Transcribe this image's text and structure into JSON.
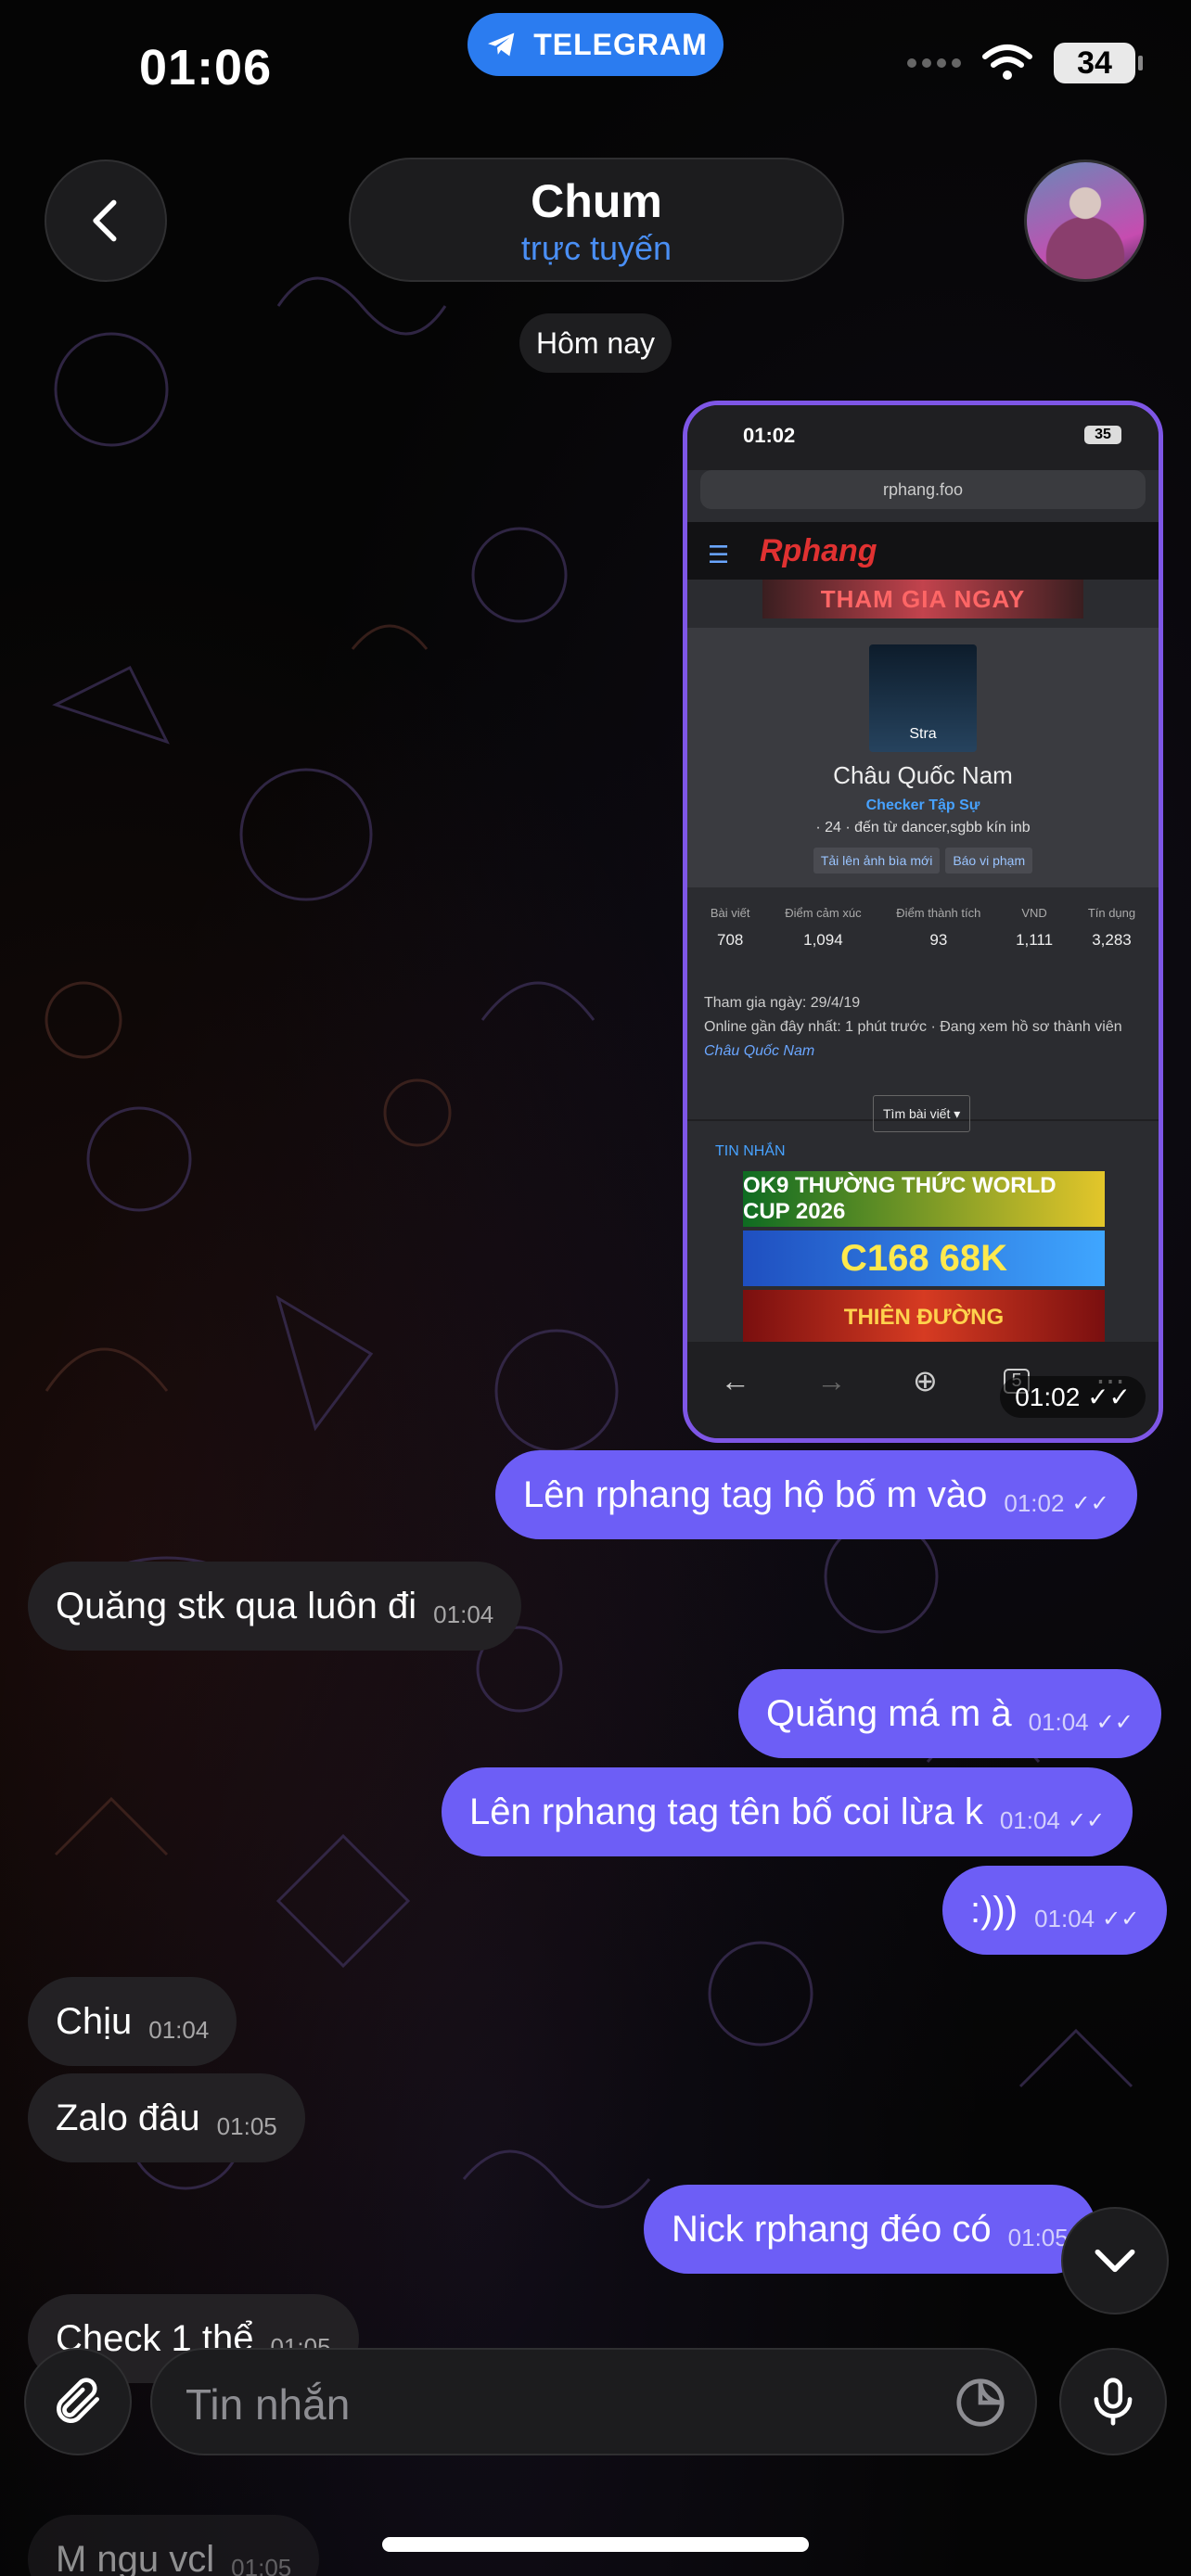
{
  "status_bar": {
    "time": "01:06",
    "pill_label": "TELEGRAM",
    "battery": "34"
  },
  "header": {
    "name": "Chum",
    "status": "trực tuyến",
    "avatar_icon": "profile-photo"
  },
  "date_chip": "Hôm nay",
  "screenshot": {
    "time": "01:02",
    "battery": "35",
    "url": "rphang.foo",
    "logo": "Rphang",
    "banner": "THAM GIA NGAY",
    "profile_name": "Châu Quốc Nam",
    "pic_label": "Stra",
    "rank": "Checker Tập Sự",
    "info": "· 24 · đến từ dancer,sgbb kín inb",
    "btn_upload": "Tải lên ảnh bìa mới",
    "btn_report": "Báo vi phạm",
    "stats": [
      {
        "k": "Bài viết",
        "v": "708"
      },
      {
        "k": "Điểm cảm xúc",
        "v": "1,094"
      },
      {
        "k": "Điểm thành tích",
        "v": "93"
      },
      {
        "k": "VND",
        "v": "1,111"
      },
      {
        "k": "Tín dụng",
        "v": "3,283"
      }
    ],
    "joined": "Tham gia ngày: 29/4/19",
    "online": "Online gần đây nhất: 1 phút trước · Đang xem hồ sơ thành viên",
    "online_link": "Châu Quốc Nam",
    "find_btn": "Tìm bài viết ▾",
    "tab_label": "TIN NHẮN",
    "ads": [
      "OK9 THƯỜNG THỨC WORLD CUP 2026",
      "C168 68K",
      "THIÊN ĐƯỜNG"
    ],
    "tab_count": "5",
    "stamp": "01:02"
  },
  "messages": [
    {
      "dir": "out",
      "text": "Lên rphang tag hộ bố m vào",
      "time": "01:02"
    },
    {
      "dir": "in",
      "text": "Quăng stk qua luôn đi",
      "time": "01:04"
    },
    {
      "dir": "out",
      "text": "Quăng má m à",
      "time": "01:04"
    },
    {
      "dir": "out",
      "text": "Lên rphang tag tên bố coi lừa k",
      "time": "01:04"
    },
    {
      "dir": "out",
      "text": ":)))",
      "time": "01:04"
    },
    {
      "dir": "in",
      "text": "Chịu",
      "time": "01:04"
    },
    {
      "dir": "in",
      "text": "Zalo đâu",
      "time": "01:05"
    },
    {
      "dir": "out",
      "text": "Nick rphang đéo có",
      "time": "01:05"
    },
    {
      "dir": "in",
      "text": "Check 1 thể",
      "time": "01:05"
    },
    {
      "dir": "in",
      "text": "M ngu vcl",
      "time": "01:05"
    }
  ],
  "composer": {
    "placeholder": "Tin nhắn"
  },
  "colors": {
    "outgoing": "#6d5ef6",
    "incoming": "#232124",
    "accent": "#4a8ff5"
  }
}
